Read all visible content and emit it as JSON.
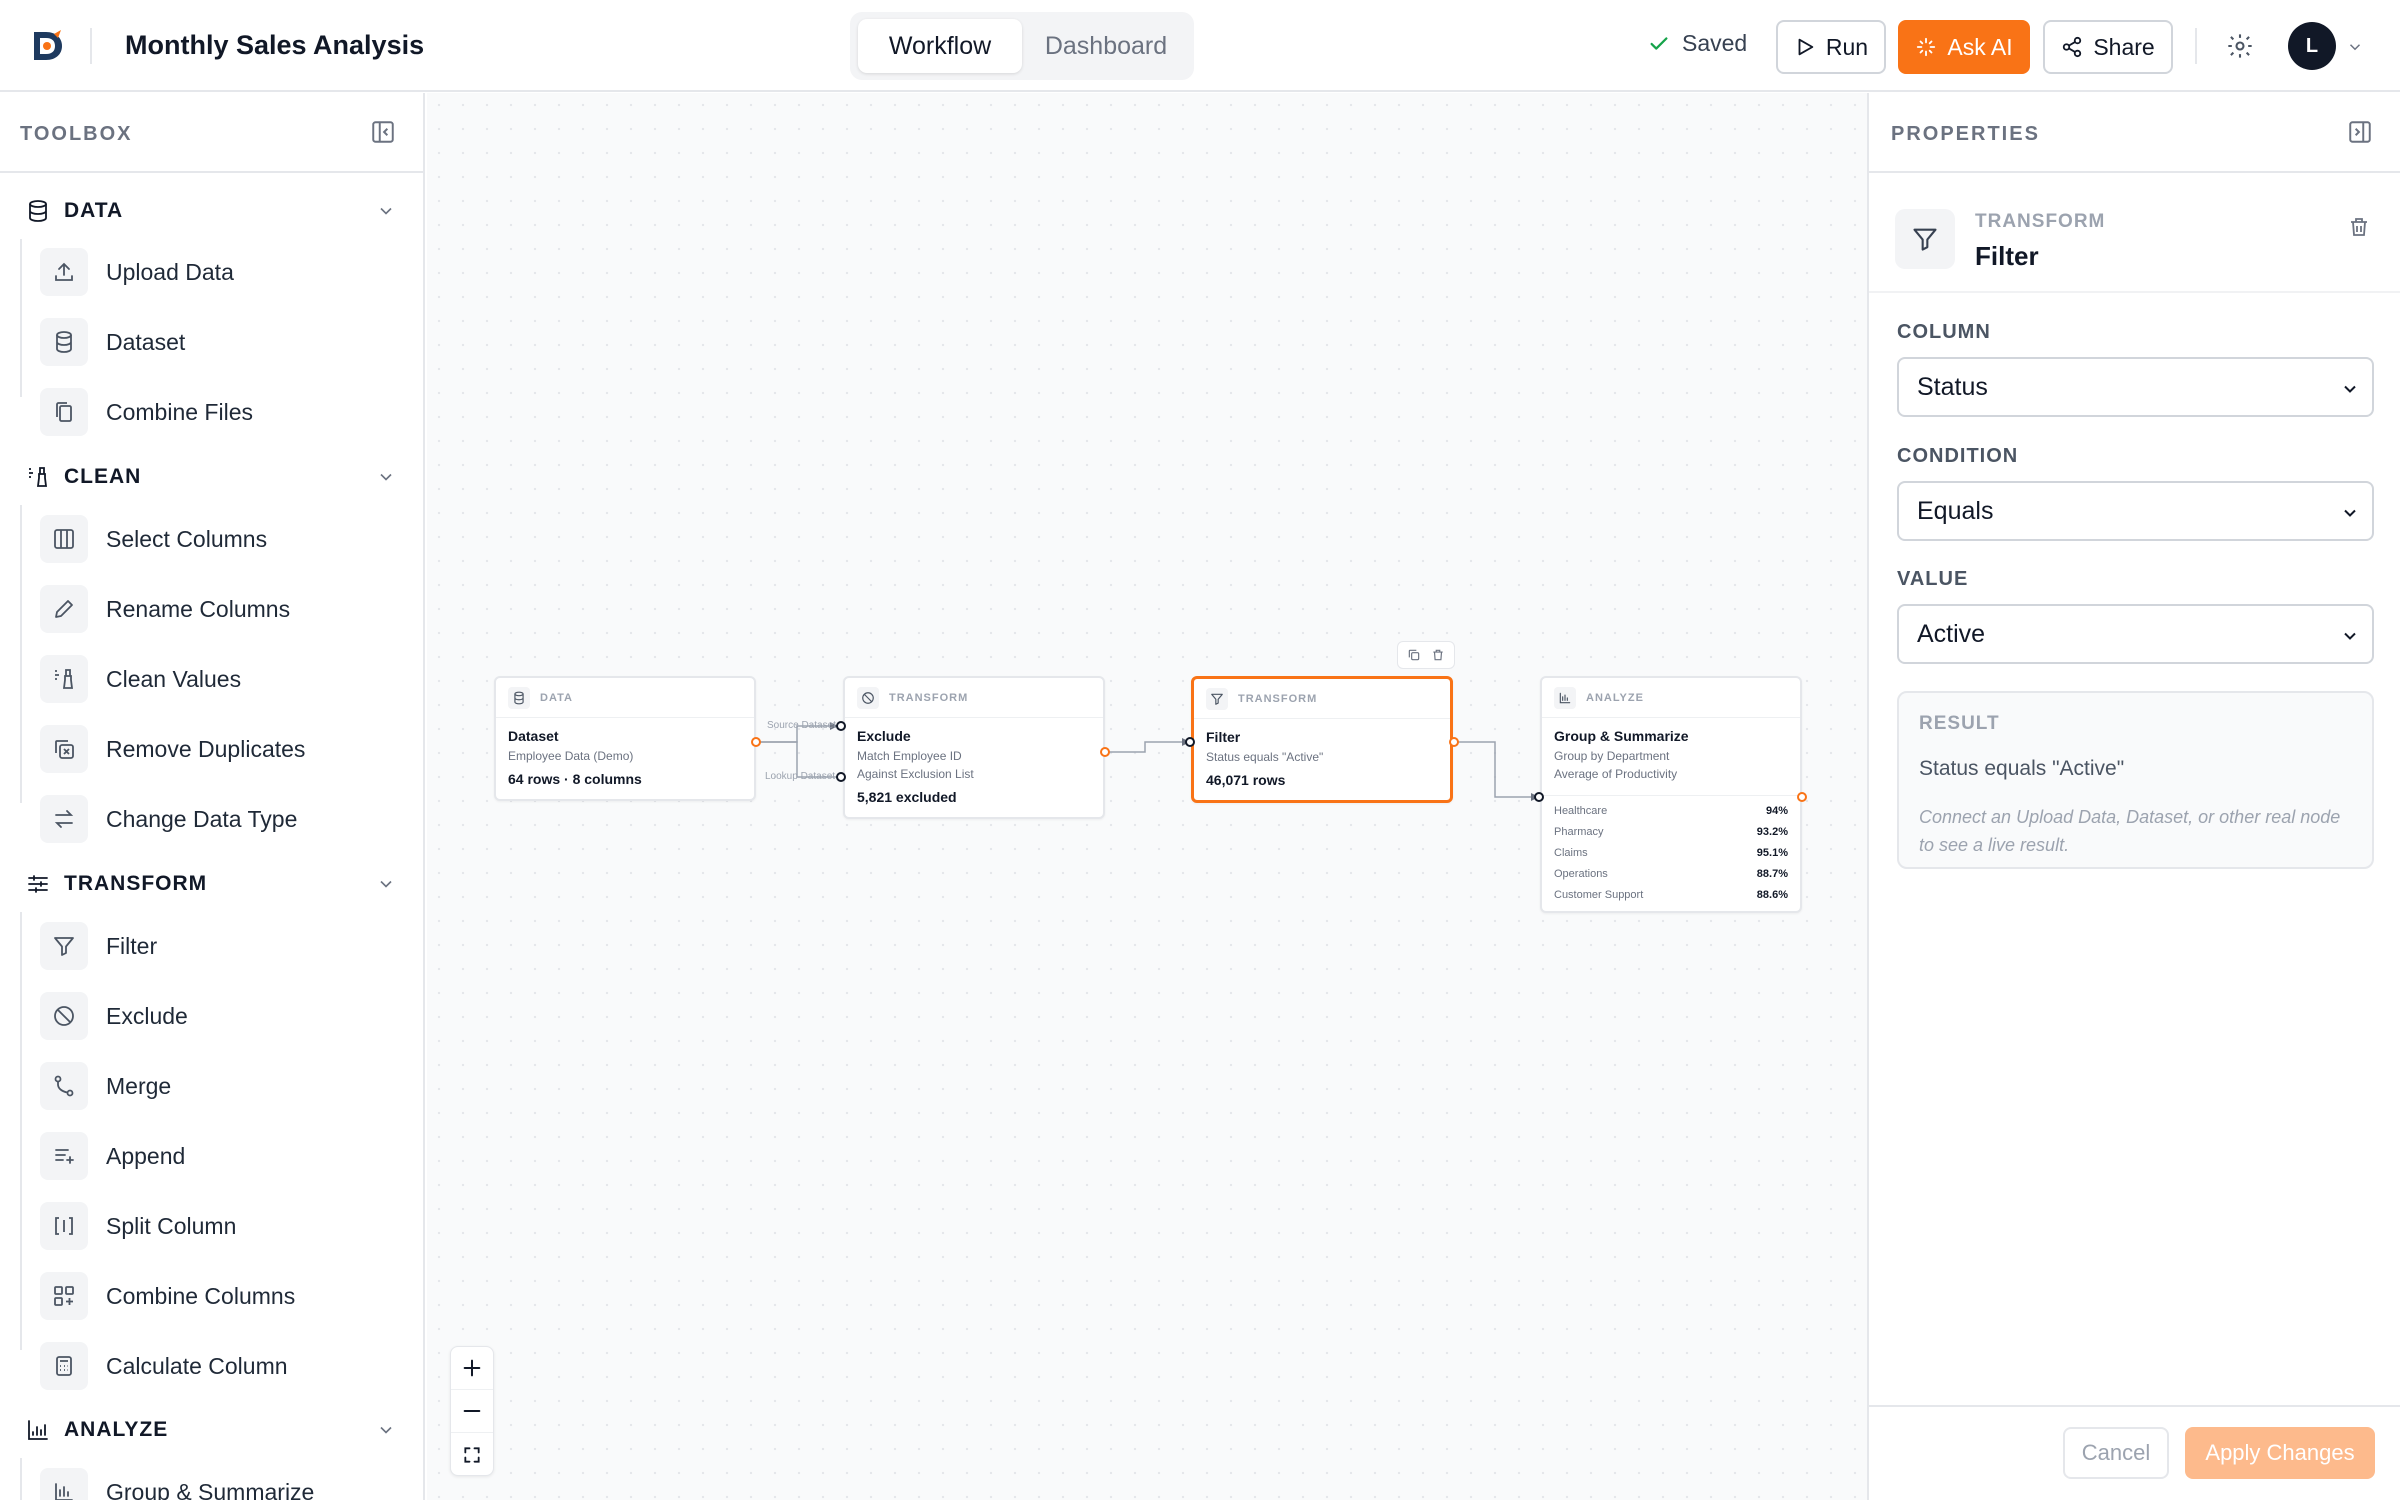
{
  "header": {
    "title": "Monthly Sales Analysis",
    "tabs": [
      {
        "label": "Workflow",
        "active": true
      },
      {
        "label": "Dashboard",
        "active": false
      }
    ],
    "saved_label": "Saved",
    "run_label": "Run",
    "ask_ai_label": "Ask AI",
    "share_label": "Share",
    "avatar_initial": "L",
    "accent_color": "#f97316"
  },
  "toolbox": {
    "title": "TOOLBOX",
    "sections": [
      {
        "label": "DATA",
        "icon": "database-icon",
        "items": [
          {
            "label": "Upload Data",
            "icon": "upload-icon"
          },
          {
            "label": "Dataset",
            "icon": "database-icon"
          },
          {
            "label": "Combine Files",
            "icon": "files-icon"
          }
        ]
      },
      {
        "label": "CLEAN",
        "icon": "brush-icon",
        "items": [
          {
            "label": "Select Columns",
            "icon": "columns-icon"
          },
          {
            "label": "Rename Columns",
            "icon": "pencil-icon"
          },
          {
            "label": "Clean Values",
            "icon": "brush-icon"
          },
          {
            "label": "Remove Duplicates",
            "icon": "duplicate-x-icon"
          },
          {
            "label": "Change Data Type",
            "icon": "arrows-swap-icon"
          }
        ]
      },
      {
        "label": "TRANSFORM",
        "icon": "sliders-icon",
        "items": [
          {
            "label": "Filter",
            "icon": "filter-icon"
          },
          {
            "label": "Exclude",
            "icon": "ban-icon"
          },
          {
            "label": "Merge",
            "icon": "merge-icon"
          },
          {
            "label": "Append",
            "icon": "append-icon"
          },
          {
            "label": "Split Column",
            "icon": "split-icon"
          },
          {
            "label": "Combine Columns",
            "icon": "combine-icon"
          },
          {
            "label": "Calculate Column",
            "icon": "calculator-icon"
          }
        ]
      },
      {
        "label": "ANALYZE",
        "icon": "chart-icon",
        "items": [
          {
            "label": "Group & Summarize",
            "icon": "chart-bars-icon"
          }
        ]
      }
    ]
  },
  "canvas": {
    "nodes": [
      {
        "category": "DATA",
        "title": "Dataset",
        "subtitle": [
          "Employee Data (Demo)"
        ],
        "stat": "64 rows · 8 columns"
      },
      {
        "category": "TRANSFORM",
        "title": "Exclude",
        "subtitle": [
          "Match Employee ID",
          "Against Exclusion List"
        ],
        "stat": "5,821 excluded",
        "port_labels": [
          "Source Dataset",
          "Lookup Dataset"
        ]
      },
      {
        "category": "TRANSFORM",
        "title": "Filter",
        "subtitle": [
          "Status equals \"Active\""
        ],
        "stat": "46,071 rows",
        "selected": true
      },
      {
        "category": "ANALYZE",
        "title": "Group & Summarize",
        "subtitle": [
          "Group by Department",
          "Average of Productivity"
        ],
        "rows": [
          {
            "label": "Healthcare",
            "value": "94%"
          },
          {
            "label": "Pharmacy",
            "value": "93.2%"
          },
          {
            "label": "Claims",
            "value": "95.1%"
          },
          {
            "label": "Operations",
            "value": "88.7%"
          },
          {
            "label": "Customer Support",
            "value": "88.6%"
          }
        ]
      }
    ]
  },
  "properties": {
    "title": "PROPERTIES",
    "node_category": "TRANSFORM",
    "node_name": "Filter",
    "fields": [
      {
        "label": "COLUMN",
        "value": "Status"
      },
      {
        "label": "CONDITION",
        "value": "Equals"
      },
      {
        "label": "VALUE",
        "value": "Active"
      }
    ],
    "result": {
      "label": "RESULT",
      "text": "Status equals \"Active\"",
      "note": "Connect an Upload Data, Dataset, or other real node to see a live result."
    },
    "cancel_label": "Cancel",
    "apply_label": "Apply Changes"
  }
}
